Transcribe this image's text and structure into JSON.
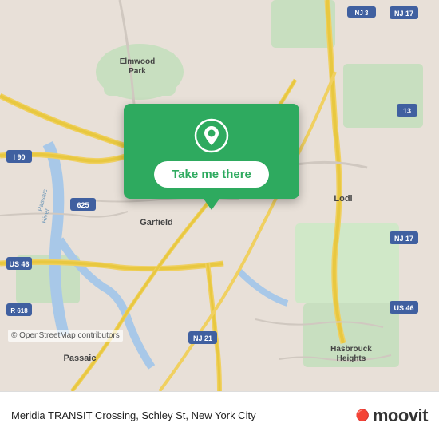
{
  "map": {
    "copyright": "© OpenStreetMap contributors"
  },
  "popup": {
    "take_me_there": "Take me there"
  },
  "bottom_bar": {
    "location": "Meridia TRANSIT Crossing, Schley St, New York City",
    "logo_icon": "🔴",
    "logo_text": "moovit"
  }
}
